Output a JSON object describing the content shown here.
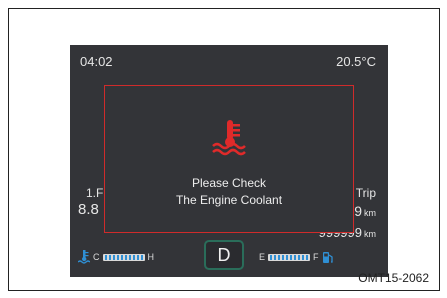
{
  "display": {
    "clock": "04:02",
    "outside_temp": "20.5°C",
    "left_label": "1.F",
    "left_value": "8.8",
    "trip_label": "Trip",
    "trip_value": "9",
    "trip_unit": "km",
    "odometer_value": "999999",
    "odometer_unit": "km"
  },
  "alert": {
    "icon": "engine-coolant-temperature-icon",
    "line1": "Please Check",
    "line2": "The Engine Coolant",
    "color": "#d02b2b"
  },
  "coolant_gauge": {
    "low_label": "C",
    "high_label": "H",
    "icon": "coolant-thermometer-icon",
    "color": "#2f8fd4"
  },
  "gear": {
    "value": "D"
  },
  "fuel_gauge": {
    "low_label": "E",
    "high_label": "F",
    "icon": "fuel-pump-icon",
    "color": "#2f8fd4"
  },
  "figure_ref": "OMT15-2062"
}
